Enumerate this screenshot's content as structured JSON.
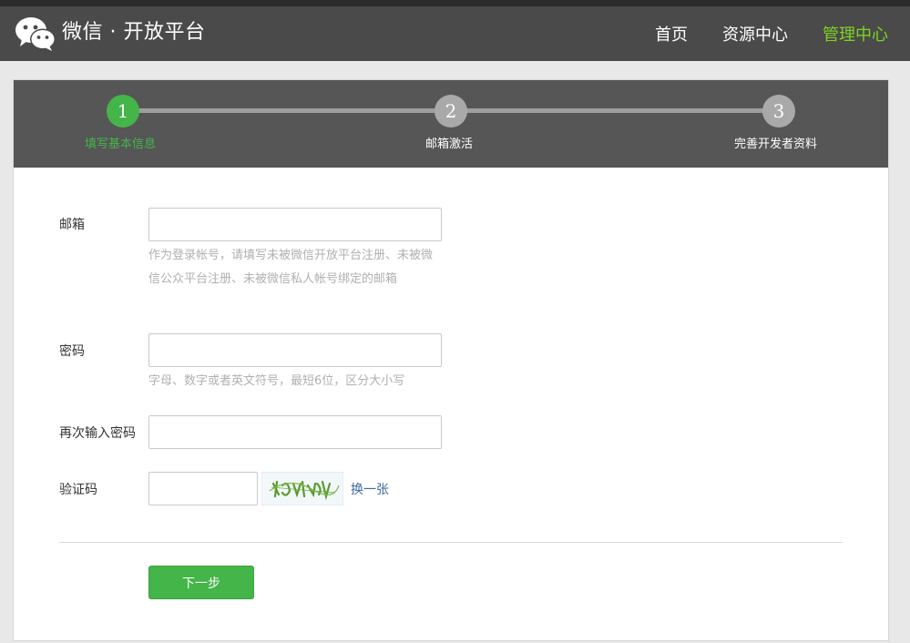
{
  "header": {
    "logo_text": "微信 · 开放平台",
    "nav": [
      {
        "label": "首页"
      },
      {
        "label": "资源中心"
      },
      {
        "label": "管理中心"
      }
    ]
  },
  "steps": [
    {
      "number": "1",
      "label": "填写基本信息"
    },
    {
      "number": "2",
      "label": "邮箱激活"
    },
    {
      "number": "3",
      "label": "完善开发者资料"
    }
  ],
  "form": {
    "email": {
      "label": "邮箱",
      "value": "",
      "hint": "作为登录帐号，请填写未被微信开放平台注册、未被微信公众平台注册、未被微信私人帐号绑定的邮箱"
    },
    "password": {
      "label": "密码",
      "value": "",
      "hint": "字母、数字或者英文符号，最短6位，区分大小写"
    },
    "confirm_password": {
      "label": "再次输入密码",
      "value": ""
    },
    "captcha": {
      "label": "验证码",
      "value": "",
      "refresh_label": "换一张"
    },
    "next_label": "下一步"
  },
  "colors": {
    "accent_green": "#44b549",
    "nav_active": "#7ed321",
    "header_bg": "#4a4a4a",
    "steps_bg": "#565656"
  }
}
